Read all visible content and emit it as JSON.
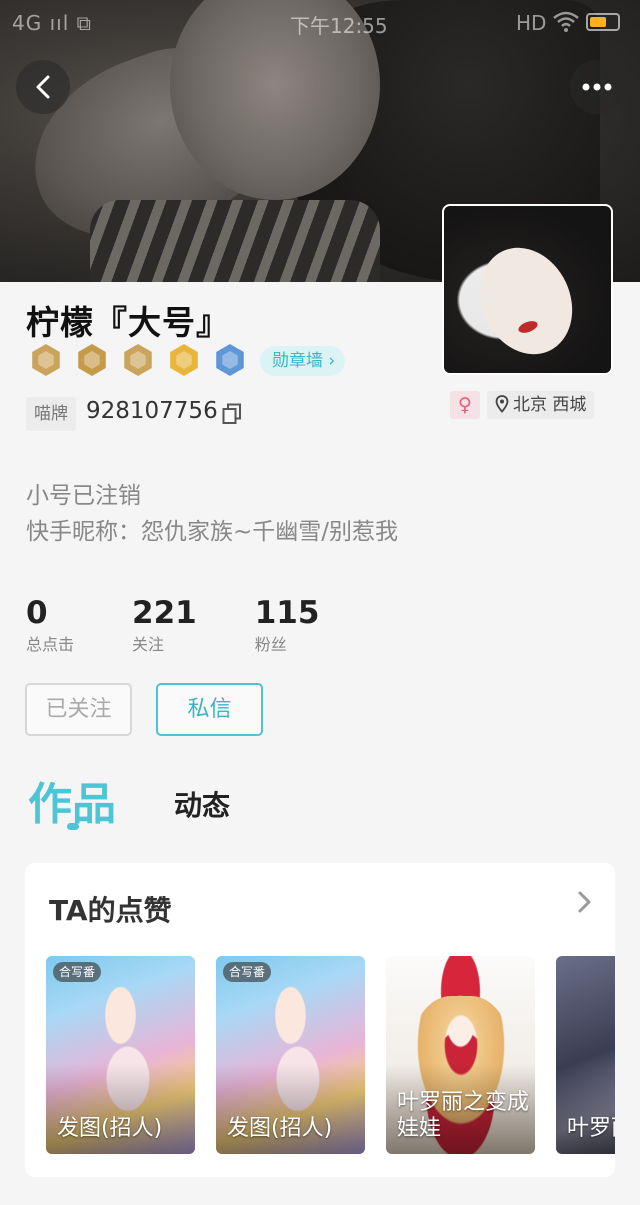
{
  "status_bar": {
    "left": "4G ııl  ⧉",
    "time": "下午12:55",
    "hd": "HD"
  },
  "nav": {
    "back": "‹",
    "more": "•••"
  },
  "profile": {
    "name": "柠檬『大号』",
    "medal_wall_label": "勋章墙 ›",
    "badges": [
      {
        "color": "#c9a45a",
        "name": "bronze-badge-1"
      },
      {
        "color": "#c59a48",
        "name": "bronze-badge-2"
      },
      {
        "color": "#c9a45a",
        "name": "bronze-badge-3"
      },
      {
        "color": "#e7b63a",
        "name": "gold-badge"
      },
      {
        "color": "#5f96d8",
        "name": "blue-badge"
      }
    ],
    "id_tag": "喵牌",
    "id": "928107756",
    "gender_symbol": "♀",
    "location": "北京 西城",
    "bio_line_1": "小号已注销",
    "bio_line_2": "快手昵称：怨仇家族~千幽雪/别惹我"
  },
  "stats": [
    {
      "value": "0",
      "label": "总点击"
    },
    {
      "value": "221",
      "label": "关注"
    },
    {
      "value": "115",
      "label": "粉丝"
    }
  ],
  "actions": {
    "followed": "已关注",
    "message": "私信"
  },
  "tabs": {
    "works": "作品",
    "feed": "动态"
  },
  "likes": {
    "title": "TA的点赞",
    "items": [
      {
        "tag": "合写番",
        "caption": "发图(招人)"
      },
      {
        "tag": "合写番",
        "caption": "发图(招人)"
      },
      {
        "tag": "",
        "caption": "叶罗丽之变成娃娃"
      },
      {
        "tag": "",
        "caption": "叶罗丽之女的"
      }
    ]
  },
  "colors": {
    "accent": "#4cc6d6",
    "gender": "#e0607d"
  }
}
